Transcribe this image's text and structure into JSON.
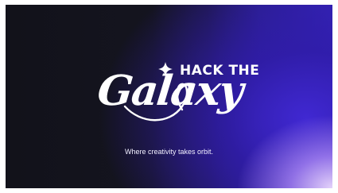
{
  "slide": {
    "headline": "HACK THE",
    "script_title": "Galaxy",
    "tagline": "Where creativity takes orbit.",
    "colors": {
      "background_dark": "#12121a",
      "background_purple": "#3424b8",
      "glow_light": "#eedcff",
      "text": "#ffffff"
    },
    "icons": [
      "sparkle-icon"
    ]
  }
}
